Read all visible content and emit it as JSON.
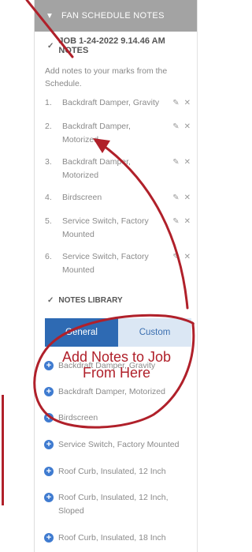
{
  "fan_schedule": {
    "title": "FAN SCHEDULE NOTES",
    "chevron_icon": "chevron-down-icon"
  },
  "job_notes": {
    "title": "JOB 1-24-2022 9.14.46 AM NOTES"
  },
  "intro": "Add notes to your marks from the Schedule.",
  "notes": [
    {
      "num": "1.",
      "text": "Backdraft Damper, Gravity"
    },
    {
      "num": "2.",
      "text": "Backdraft Damper, Motorized"
    },
    {
      "num": "3.",
      "text": "Backdraft Damper, Motorized"
    },
    {
      "num": "4.",
      "text": "Birdscreen"
    },
    {
      "num": "5.",
      "text": "Service Switch, Factory Mounted"
    },
    {
      "num": "6.",
      "text": "Service Switch, Factory Mounted"
    }
  ],
  "library": {
    "title": "NOTES LIBRARY",
    "tabs": [
      "General",
      "Custom"
    ],
    "items": [
      "Backdraft Damper, Gravity",
      "Backdraft Damper, Motorized",
      "Birdscreen",
      "Service Switch, Factory Mounted",
      "Roof Curb, Insulated, 12 Inch",
      "Roof Curb, Insulated, 12 Inch, Sloped",
      "Roof Curb, Insulated, 18 Inch"
    ]
  },
  "annotation": {
    "line1": "Add Notes to Job",
    "line2": "From Here"
  },
  "colors": {
    "accent": "#2e6ab3",
    "annotation": "#b0202a",
    "header_gray": "#a3a3a3"
  }
}
